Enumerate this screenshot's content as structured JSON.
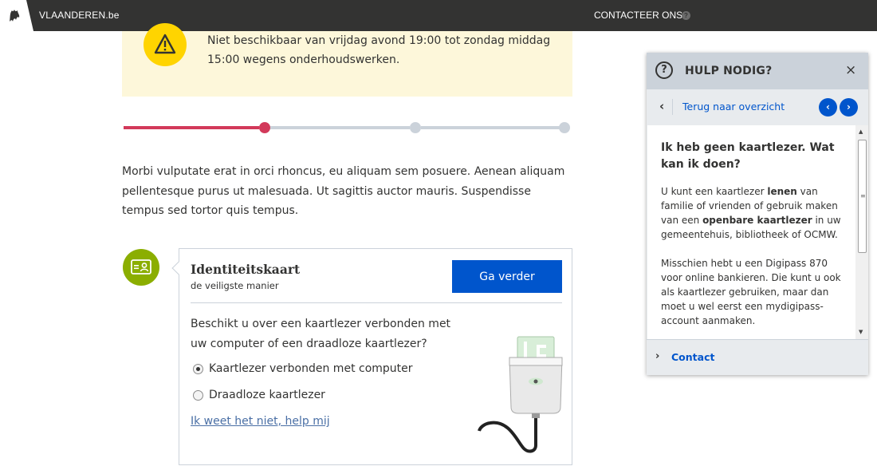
{
  "topbar": {
    "brand": "VLAANDEREN.be",
    "contact_label": "CONTACTEER ONS",
    "help_glyph": "?"
  },
  "banner": {
    "icon": "warning-icon",
    "text": "Niet beschikbaar van vrijdag avond 19:00 tot zondag middag 15:00 wegens onderhoudswerken.",
    "bg_color": "#fdf7da",
    "icon_color": "#ffd400"
  },
  "progress": {
    "current_step": 1,
    "total_steps": 3,
    "active_color": "#d2395a",
    "inactive_color": "#cbd2da"
  },
  "intro": "Morbi vulputate erat in orci rhoncus, eu aliquam sem posuere. Aenean aliquam pellentesque purus ut malesuada. Ut sagittis auctor mauris. Suspendisse tempus sed tortor quis tempus.",
  "option": {
    "title": "Identiteitskaart",
    "subtitle": "de veiligste manier",
    "button": "Ga verder",
    "question": "Beschikt u over een kaartlezer verbonden met uw computer of een draadloze kaartlezer?",
    "radios": [
      {
        "label": "Kaartlezer verbonden met computer",
        "checked": true
      },
      {
        "label": "Draadloze kaartlezer",
        "checked": false
      }
    ],
    "help_link": "Ik weet het niet, help mij",
    "accent_color": "#8bae00",
    "button_color": "#0055cc"
  },
  "help_panel": {
    "title": "HULP NODIG?",
    "question_glyph": "?",
    "close_glyph": "×",
    "back_glyph": "‹",
    "back_label": "Terug naar overzicht",
    "prev_glyph": "‹",
    "next_glyph": "›",
    "heading": "Ik heb geen kaartlezer. Wat kan ik doen?",
    "para1": {
      "t1": "U kunt een kaartlezer ",
      "b1": "lenen",
      "t2": " van familie of vrienden of gebruik maken van een ",
      "b2": "openbare kaartlezer",
      "t3": " in uw gemeentehuis, bibliotheek of OCMW."
    },
    "para2": "Misschien hebt u een Digipass 870 voor online bankieren. Die kunt u ook als kaartlezer gebruiken, maar dan moet u wel eerst een mydigipass-account aanmaken.",
    "footer_glyph": "›",
    "footer_label": "Contact"
  }
}
